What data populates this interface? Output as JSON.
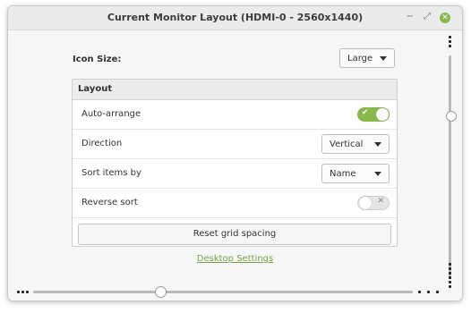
{
  "window": {
    "title": "Current Monitor Layout (HDMI-0 - 2560x1440)",
    "minimize_glyph": "−",
    "maximize_glyph": "⤢",
    "close_glyph": "✕"
  },
  "icon_size": {
    "label": "Icon Size:",
    "value": "Large"
  },
  "layout": {
    "header": "Layout",
    "rows": [
      {
        "label": "Auto-arrange",
        "control": "switch",
        "state": "on",
        "glyph": "✔"
      },
      {
        "label": "Direction",
        "control": "dropdown",
        "value": "Vertical"
      },
      {
        "label": "Sort items by",
        "control": "dropdown",
        "value": "Name"
      },
      {
        "label": "Reverse sort",
        "control": "switch",
        "state": "off",
        "glyph": "✕"
      }
    ],
    "reset_button": "Reset grid spacing"
  },
  "desktop_settings_link": "Desktop Settings",
  "colors": {
    "accent": "#8ab84e",
    "link": "#74a34a"
  }
}
